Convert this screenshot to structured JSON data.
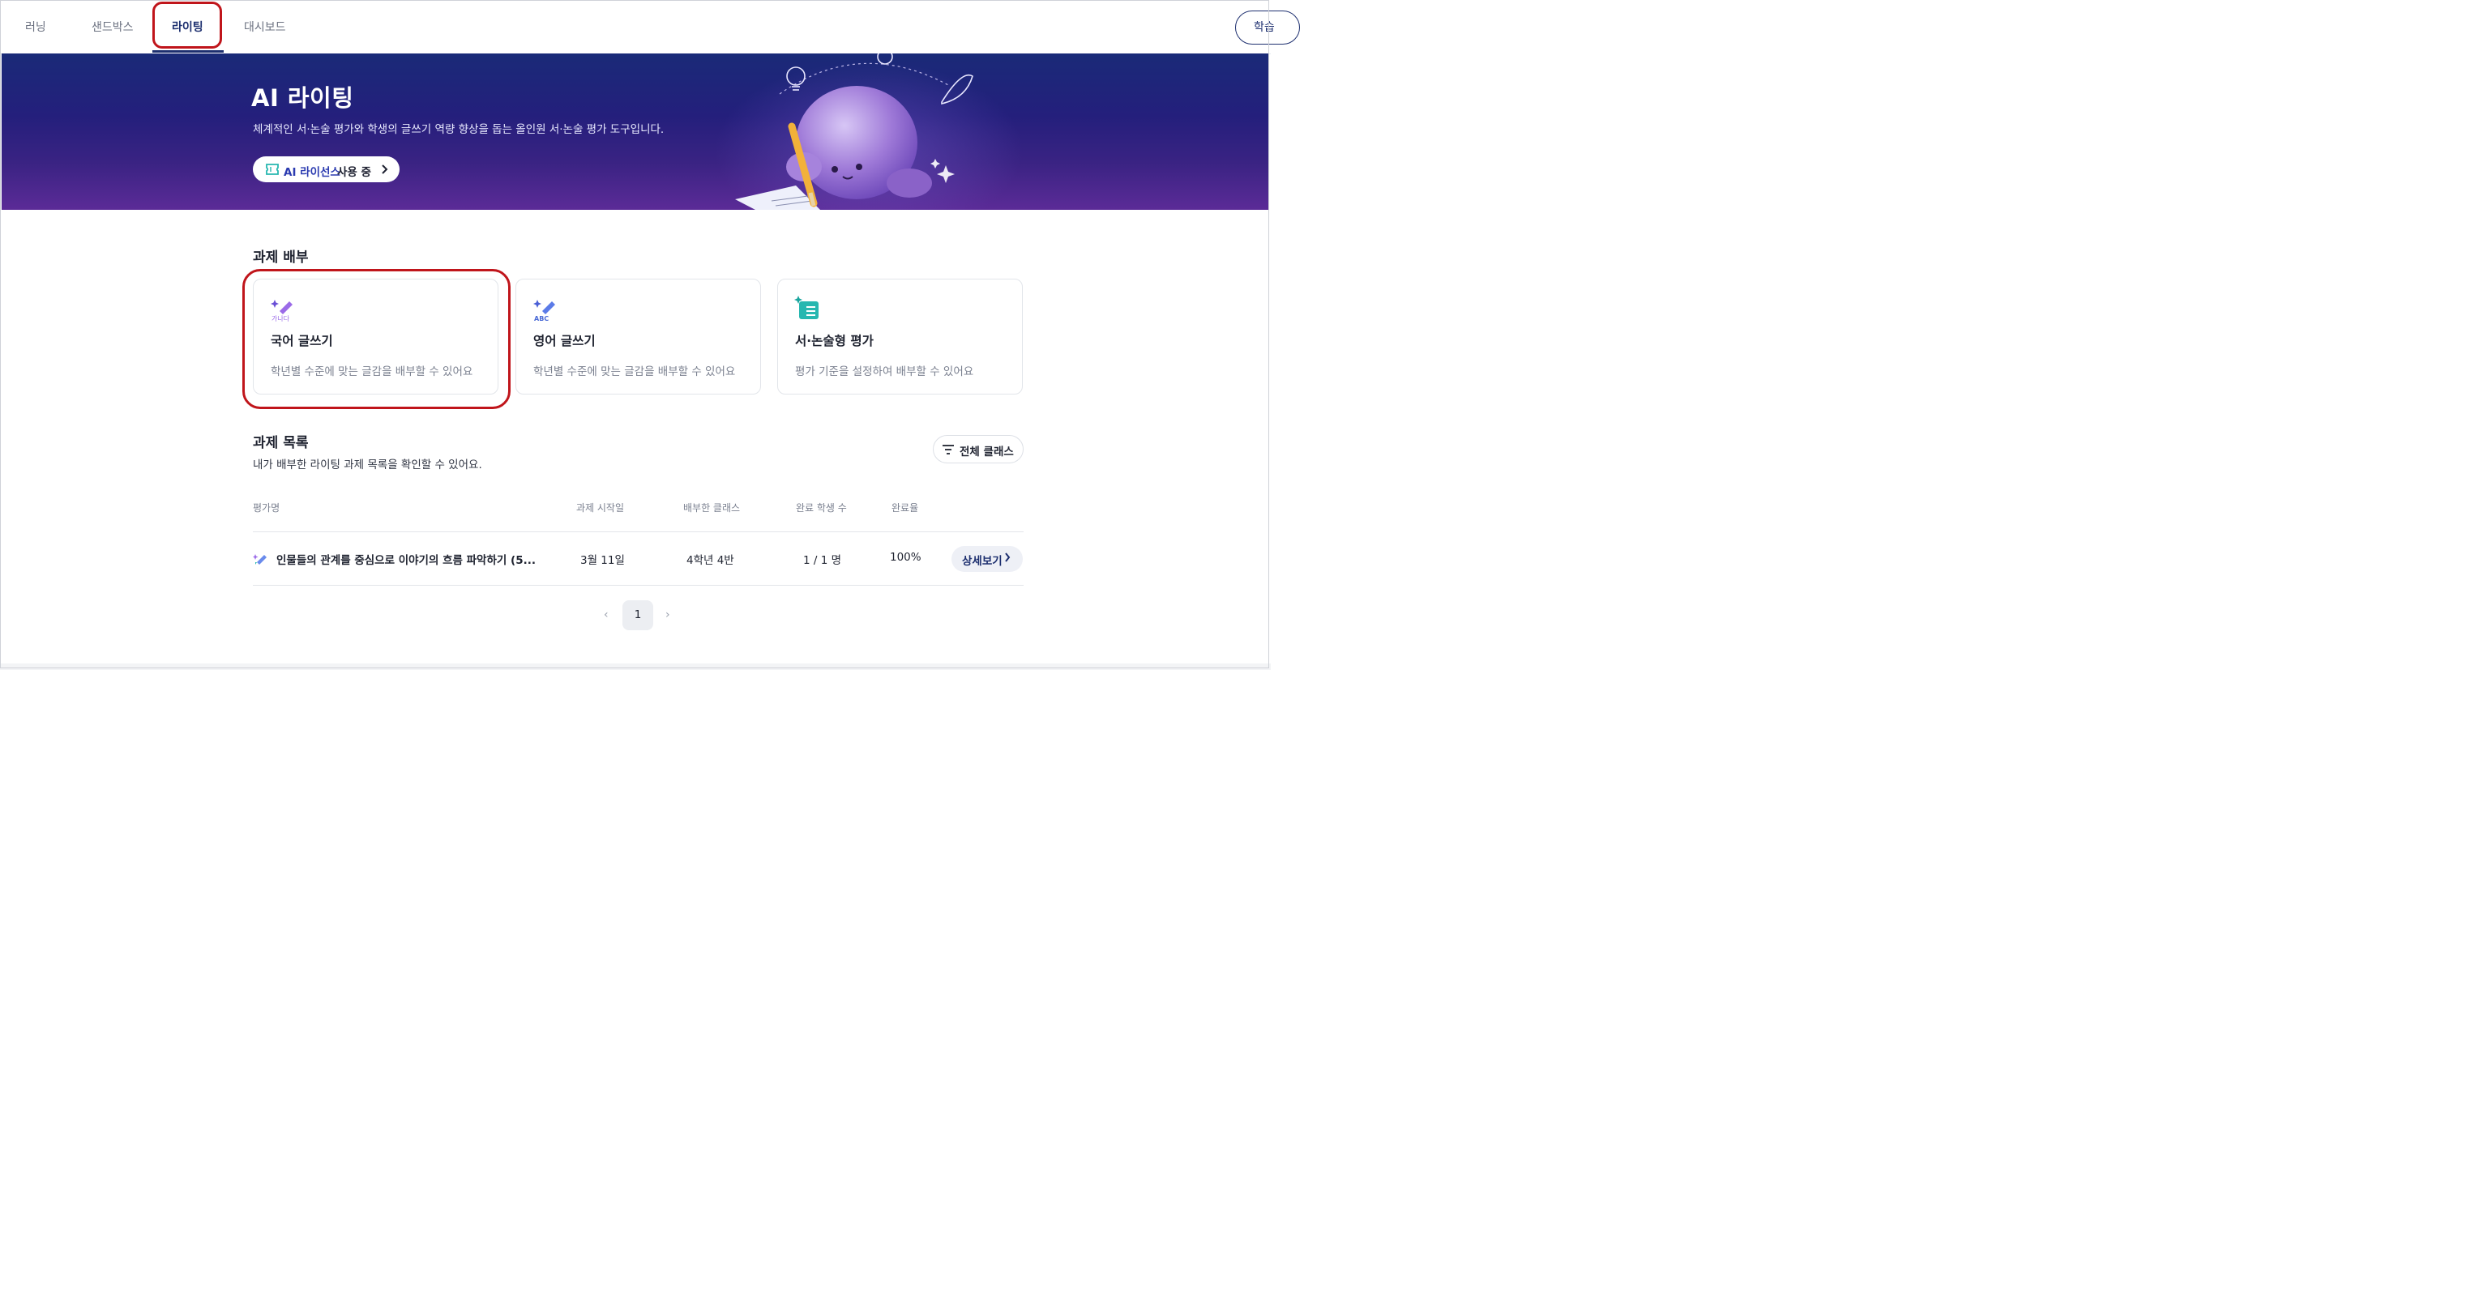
{
  "nav": {
    "tabs": [
      {
        "label": "러닝"
      },
      {
        "label": "샌드박스"
      },
      {
        "label": "라이팅",
        "active": true
      },
      {
        "label": "대시보드"
      }
    ],
    "right_button_label": "학습"
  },
  "hero": {
    "title": "AI 라이팅",
    "description": "체계적인 서·논술 평가와 학생의 글쓰기 역량 향상을 돕는 올인원 서·논술 평가 도구입니다.",
    "license": {
      "accent": "AI 라이선스",
      "rest": "사용 중",
      "icon": "ticket-icon"
    }
  },
  "assign": {
    "title": "과제 배부",
    "cards": [
      {
        "icon": "pen-sparkle-icon",
        "icon_caption": "가나다",
        "title": "국어 글쓰기",
        "desc": "학년별 수준에 맞는 글감을 배부할 수 있어요"
      },
      {
        "icon": "pen-sparkle-icon",
        "icon_caption": "ABC",
        "title": "영어 글쓰기",
        "desc": "학년별 수준에 맞는 글감을 배부할 수 있어요"
      },
      {
        "icon": "checklist-sparkle-icon",
        "title": "서·논술형 평가",
        "desc": "평가 기준을 설정하여 배부할 수 있어요"
      }
    ]
  },
  "list": {
    "title": "과제 목록",
    "subtitle": "내가 배부한 라이팅 과제 목록을 확인할 수 있어요.",
    "filter_label": "전체 클래스",
    "columns": [
      "평가명",
      "과제 시작일",
      "배부한 클래스",
      "완료 학생 수",
      "완료율"
    ],
    "rows": [
      {
        "title": "인물들의 관계를 중심으로 이야기의 흐름 파악하기 (5...",
        "start": "3월 11일",
        "class": "4학년 4반",
        "done": "1 / 1 명",
        "rate": "100%",
        "action": "상세보기"
      }
    ]
  },
  "pagination": {
    "current": "1",
    "prev": "‹",
    "next": "›"
  },
  "colors": {
    "primary": "#1d2f6f",
    "highlight": "#c0151b",
    "accent_purple": "#8b5cf6",
    "accent_teal": "#27b7b0"
  }
}
